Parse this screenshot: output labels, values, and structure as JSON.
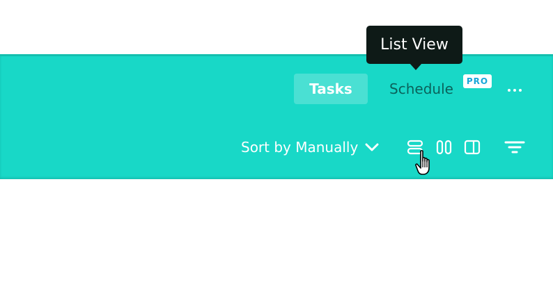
{
  "header": {
    "tabs": [
      {
        "label": "Tasks",
        "active": true
      },
      {
        "label": "Schedule",
        "active": false
      }
    ],
    "pro_badge": "PRO",
    "more_icon": "ellipsis-icon"
  },
  "tooltip": {
    "text": "List View"
  },
  "toolbar": {
    "sort_label": "Sort by Manually",
    "sort_icon": "chevron-down-icon",
    "views": [
      {
        "icon": "list-view-icon"
      },
      {
        "icon": "board-view-icon"
      },
      {
        "icon": "split-view-icon"
      }
    ],
    "filter_icon": "filter-icon"
  },
  "colors": {
    "toolbar_bg": "#18d8c7",
    "tooltip_bg": "#0e1a17",
    "pro_text": "#18a7d9"
  }
}
